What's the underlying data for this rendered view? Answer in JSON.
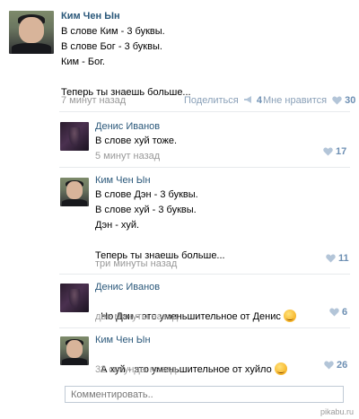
{
  "post": {
    "author": "Ким Чен Ын",
    "text": "В слове Ким - 3 буквы.\nВ слове Бог - 3 буквы.\nКим - Бог.\n\nТеперь ты знаешь больше...",
    "time": "7 минут назад",
    "share_label": "Поделиться",
    "share_count": "4",
    "like_label": "Мне нравится",
    "like_count": "30"
  },
  "comments": [
    {
      "author": "Денис Иванов",
      "text": "В слове хуй тоже.",
      "time": "5 минут назад",
      "likes": "17"
    },
    {
      "author": "Ким Чен Ын",
      "text": "В слове Дэн - 3 буквы.\nВ слове хуй - 3 буквы.\nДэн - хуй.\n\nТеперь ты знаешь больше...",
      "time": "три минуты назад",
      "likes": "11"
    },
    {
      "author": "Денис Иванов",
      "text": "Но Дэн - это уменьшительное от Денис",
      "time": "две минуты назад",
      "likes": "6"
    },
    {
      "author": "Ким Чен Ын",
      "text": "А хуй - это уменьшительное от хуйло",
      "time": "32 секунды назад",
      "likes": "26"
    }
  ],
  "comment_input": {
    "placeholder": "Комментировать.."
  },
  "watermark": "pikabu.ru",
  "colors": {
    "link": "#2b587a",
    "meta": "#999999",
    "heart": "#b3c5d8",
    "like_count": "#6d8fb3"
  }
}
